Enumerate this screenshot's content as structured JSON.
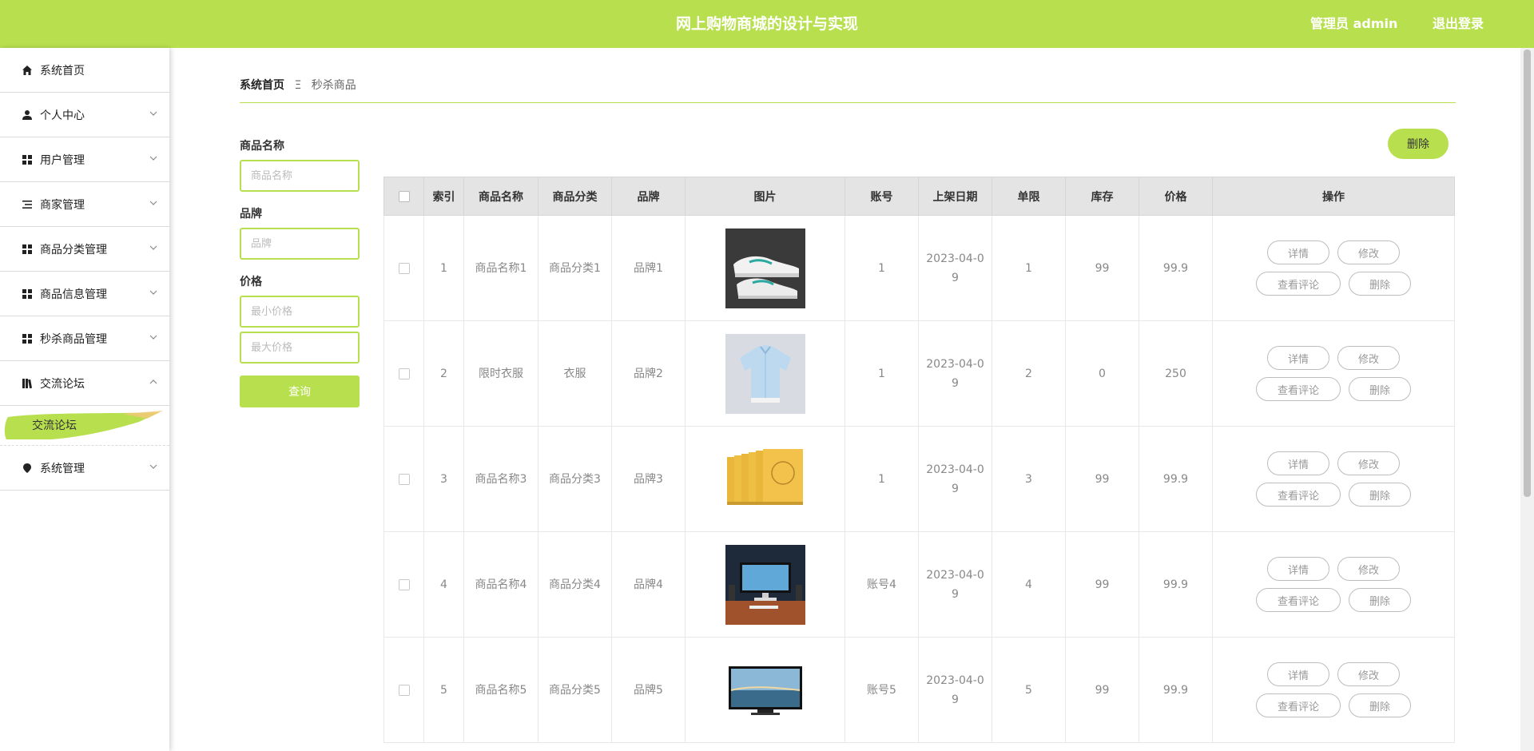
{
  "header": {
    "title": "网上购物商城的设计与实现",
    "admin_label": "管理员 admin",
    "logout_label": "退出登录"
  },
  "colors": {
    "accent": "#b8e04e",
    "header_text": "#ffffff",
    "table_header_bg": "#e4e4e4"
  },
  "sidebar": {
    "items": [
      {
        "label": "系统首页",
        "icon": "home-icon"
      },
      {
        "label": "个人中心",
        "icon": "user-icon"
      },
      {
        "label": "用户管理",
        "icon": "grid-icon"
      },
      {
        "label": "商家管理",
        "icon": "list-icon"
      },
      {
        "label": "商品分类管理",
        "icon": "grid-icon"
      },
      {
        "label": "商品信息管理",
        "icon": "grid-icon"
      },
      {
        "label": "秒杀商品管理",
        "icon": "grid-icon"
      },
      {
        "label": "交流论坛",
        "icon": "book-icon"
      },
      {
        "label": "系统管理",
        "icon": "pin-icon"
      }
    ],
    "submenu": {
      "label": "交流论坛"
    }
  },
  "breadcrumb": {
    "home": "系统首页",
    "separator": "Ξ",
    "current": "秒杀商品"
  },
  "search": {
    "name_label": "商品名称",
    "name_placeholder": "商品名称",
    "brand_label": "品牌",
    "brand_placeholder": "品牌",
    "price_label": "价格",
    "min_price_placeholder": "最小价格",
    "max_price_placeholder": "最大价格",
    "query_label": "查询"
  },
  "toolbar": {
    "delete_label": "删除"
  },
  "table": {
    "columns": [
      "索引",
      "商品名称",
      "商品分类",
      "品牌",
      "图片",
      "账号",
      "上架日期",
      "单限",
      "库存",
      "价格",
      "操作"
    ],
    "actions": {
      "detail": "详情",
      "edit": "修改",
      "comments": "查看评论",
      "delete": "删除"
    },
    "rows": [
      {
        "index": "1",
        "name": "商品名称1",
        "category": "商品分类1",
        "brand": "品牌1",
        "image": "sneaker-image",
        "account": "1",
        "date_a": "2023-04-0",
        "date_b": "9",
        "limit": "1",
        "stock": "99",
        "price": "99.9"
      },
      {
        "index": "2",
        "name": "限时衣服",
        "category": "衣服",
        "brand": "品牌2",
        "image": "shirt-image",
        "account": "1",
        "date_a": "2023-04-0",
        "date_b": "9",
        "limit": "2",
        "stock": "0",
        "price": "250"
      },
      {
        "index": "3",
        "name": "商品名称3",
        "category": "商品分类3",
        "brand": "品牌3",
        "image": "books-image",
        "account": "1",
        "date_a": "2023-04-0",
        "date_b": "9",
        "limit": "3",
        "stock": "99",
        "price": "99.9"
      },
      {
        "index": "4",
        "name": "商品名称4",
        "category": "商品分类4",
        "brand": "品牌4",
        "image": "monitor-desk-image",
        "account": "账号4",
        "date_a": "2023-04-0",
        "date_b": "9",
        "limit": "4",
        "stock": "99",
        "price": "99.9"
      },
      {
        "index": "5",
        "name": "商品名称5",
        "category": "商品分类5",
        "brand": "品牌5",
        "image": "tv-image",
        "account": "账号5",
        "date_a": "2023-04-0",
        "date_b": "9",
        "limit": "5",
        "stock": "99",
        "price": "99.9"
      }
    ]
  }
}
